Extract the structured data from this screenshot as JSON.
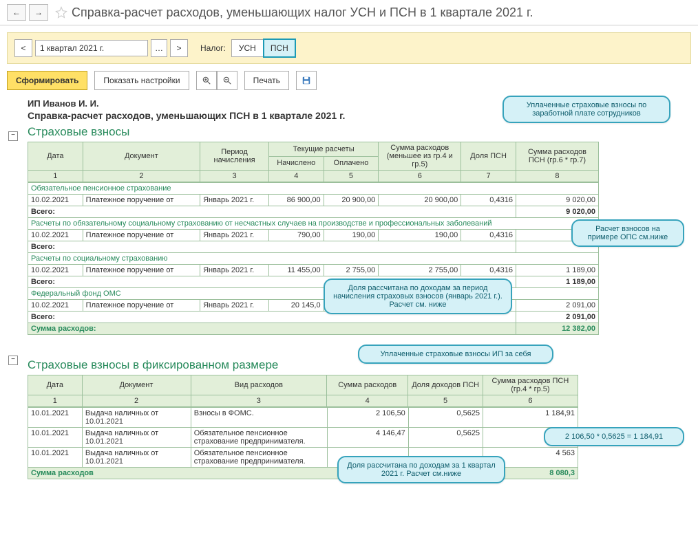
{
  "title": "Справка-расчет расходов, уменьшающих налог УСН и ПСН в 1 квартале 2021 г.",
  "period": "1 квартал 2021 г.",
  "tax_label": "Налог:",
  "tabs": {
    "usn": "УСН",
    "psn": "ПСН"
  },
  "buttons": {
    "form": "Сформировать",
    "settings": "Показать настройки",
    "print": "Печать"
  },
  "ip": "ИП Иванов И. И.",
  "report_title": "Справка-расчет расходов, уменьшающих ПСН в 1 квартале 2021 г.",
  "section1": {
    "title": "Страховые взносы",
    "headers": {
      "date": "Дата",
      "doc": "Документ",
      "period": "Период начисления",
      "cur": "Текущие расчеты",
      "acc": "Начислено",
      "paid": "Оплачено",
      "sum": "Сумма расходов (меньшее из гр.4 и гр.5)",
      "share": "Доля ПСН",
      "psn": "Сумма расходов ПСН (гр.6 * гр.7)"
    },
    "nums": [
      "1",
      "2",
      "3",
      "4",
      "5",
      "6",
      "7",
      "8"
    ],
    "groups": [
      {
        "title": "Обязательное пенсионное страхование",
        "rows": [
          {
            "date": "10.02.2021",
            "doc": "Платежное поручение от",
            "period": "Январь 2021 г.",
            "acc": "86 900,00",
            "paid": "20 900,00",
            "sum": "20 900,00",
            "share": "0,4316",
            "psn": "9 020,00"
          }
        ],
        "total": "9 020,00"
      },
      {
        "title": "Расчеты по обязательному социальному страхованию от несчастных случаев на производстве и профессиональных заболеваний",
        "rows": [
          {
            "date": "10.02.2021",
            "doc": "Платежное поручение от",
            "period": "Январь 2021 г.",
            "acc": "790,00",
            "paid": "190,00",
            "sum": "190,00",
            "share": "0,4316",
            "psn": ""
          }
        ],
        "total": ""
      },
      {
        "title": "Расчеты по социальному страхованию",
        "rows": [
          {
            "date": "10.02.2021",
            "doc": "Платежное поручение от",
            "period": "Январь 2021 г.",
            "acc": "11 455,00",
            "paid": "2 755,00",
            "sum": "2 755,00",
            "share": "0,4316",
            "psn": "1 189,00"
          }
        ],
        "total": "1 189,00"
      },
      {
        "title": "Федеральный фонд ОМС",
        "rows": [
          {
            "date": "10.02.2021",
            "doc": "Платежное поручение от",
            "period": "Январь 2021 г.",
            "acc": "20 145,0",
            "paid": "",
            "sum": "",
            "share": "",
            "psn": "2 091,00"
          }
        ],
        "total": "2 091,00"
      }
    ],
    "total_label": "Всего:",
    "grand_label": "Сумма расходов:",
    "grand": "12 382,00"
  },
  "section2": {
    "title": "Страховые взносы в фиксированном размере",
    "headers": {
      "date": "Дата",
      "doc": "Документ",
      "type": "Вид расходов",
      "sum": "Сумма расходов",
      "share": "Доля доходов ПСН",
      "psn": "Сумма расходов ПСН (гр.4 * гр.5)"
    },
    "nums": [
      "1",
      "2",
      "3",
      "4",
      "5",
      "6"
    ],
    "rows": [
      {
        "date": "10.01.2021",
        "doc": "Выдача наличных  от 10.01.2021",
        "type": "Взносы в ФОМС.",
        "sum": "2 106,50",
        "share": "0,5625",
        "psn": "1 184,91"
      },
      {
        "date": "10.01.2021",
        "doc": "Выдача наличных  от 10.01.2021",
        "type": "Обязательное пенсионное страхование предпринимателя.",
        "sum": "4 146,47",
        "share": "0,5625",
        "psn": ""
      },
      {
        "date": "10.01.2021",
        "doc": "Выдача наличных  от 10.01.2021",
        "type": "Обязательное пенсионное страхование предпринимателя.",
        "sum": "",
        "share": "",
        "psn": "4 563"
      }
    ],
    "grand_label": "Сумма расходов",
    "grand": "8 080,3"
  },
  "callouts": {
    "c1": "Уплаченные страховые взносы по заработной плате сотрудников",
    "c2": "Расчет взносов на примере ОПС см.ниже",
    "c3": "Доля рассчитана по доходам за период начисления страховых взносов (январь 2021 г.). Расчет см. ниже",
    "c4": "Уплаченные страховые взносы ИП за себя",
    "c5": "2 106,50 * 0,5625 = 1 184,91",
    "c6": "Доля рассчитана по доходам за 1 квартал 2021 г. Расчет см.ниже"
  }
}
